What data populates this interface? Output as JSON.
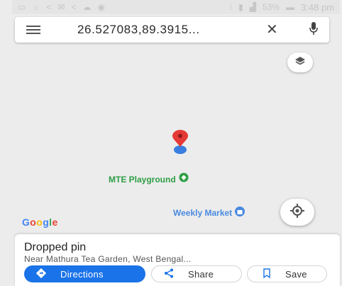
{
  "status_bar": {
    "left_icons": [
      "window-icon",
      "sun-icon",
      "share-icon",
      "mail-icon",
      "share-icon",
      "cloud-icon",
      "location-icon"
    ],
    "right_icons": [
      "vibrate-icon",
      "sim-icon",
      "signal-icon"
    ],
    "battery": "53%",
    "time": "3:48 pm"
  },
  "search": {
    "value": "26.527083,89.3915..."
  },
  "map": {
    "labels": {
      "mte": "MTE Playground",
      "weekly": "Weekly Market"
    },
    "attribution": "Google",
    "pin_color": "#e53935",
    "location_dot_color": "#3a7ee0"
  },
  "sheet": {
    "title": "Dropped pin",
    "subtitle": "Near Mathura Tea Garden, West Bengal...",
    "buttons": {
      "directions": "Directions",
      "share": "Share",
      "save": "Save"
    }
  },
  "colors": {
    "accent": "#1a73e8",
    "place_green": "#2e9e44",
    "map_background": "#ececec"
  }
}
